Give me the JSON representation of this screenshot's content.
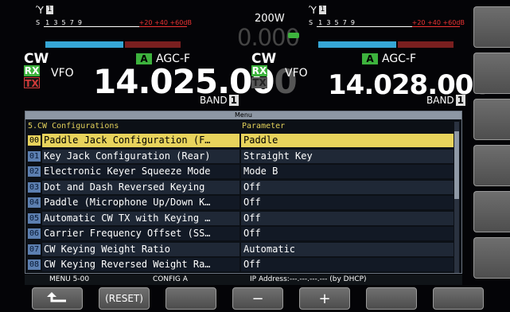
{
  "left_vfo": {
    "meter_scale": "S 1 3 5 7 9 +20 +40 +60dB",
    "meter_scale_red": "+20 +40 +60dB",
    "antenna_num": "1",
    "mode": "CW",
    "agc_badge": "A",
    "agc": "AGC-F",
    "rx_label": "RX",
    "tx_label": "TX",
    "vfo_label": "VFO",
    "freq_main": "14.025.00",
    "freq_dim": "0",
    "band_label": "BAND",
    "band_num": "1"
  },
  "center": {
    "power": "200W",
    "power_value": "0.000"
  },
  "right_vfo": {
    "meter_scale": "S 1 3 5 7 9 +20 +40 +60dB",
    "antenna_num": "1",
    "mode": "CW",
    "agc_badge": "A",
    "agc": "AGC-F",
    "rx_label": "RX",
    "tx_label": "TX",
    "vfo_label": "VFO",
    "freq_main": "14.028.00",
    "freq_dim": "0",
    "band_label": "BAND",
    "band_num": "1"
  },
  "menu": {
    "title": "Menu",
    "group_header": "5.CW Configurations",
    "param_header": "Parameter",
    "rows": [
      {
        "num": "00",
        "name": "Paddle Jack Configuration (F…",
        "value": "Paddle"
      },
      {
        "num": "01",
        "name": "Key Jack Configuration (Rear)",
        "value": "Straight Key"
      },
      {
        "num": "02",
        "name": "Electronic Keyer Squeeze Mode",
        "value": "Mode B"
      },
      {
        "num": "03",
        "name": "Dot and Dash Reversed Keying",
        "value": "Off"
      },
      {
        "num": "04",
        "name": "Paddle (Microphone Up/Down K…",
        "value": "Off"
      },
      {
        "num": "05",
        "name": "Automatic CW TX with Keying …",
        "value": "Off"
      },
      {
        "num": "06",
        "name": "Carrier Frequency Offset (SS…",
        "value": "Off"
      },
      {
        "num": "07",
        "name": "CW Keying Weight Ratio",
        "value": "Automatic"
      },
      {
        "num": "08",
        "name": "CW Keying Reversed Weight Ra…",
        "value": "Off"
      }
    ]
  },
  "status_bar": {
    "menu_pos": "MENU 5-00",
    "config": "CONFIG A",
    "ip": "IP Address:---.---.---.--- (by DHCP)"
  },
  "function_keys": {
    "back_icon": "return-arrow-icon",
    "reset": "(RESET)",
    "minus": "−",
    "plus": "+"
  },
  "colors": {
    "selected_row": "#e8d35c",
    "rx_green": "#3db33d",
    "tx_red": "#d23a3a",
    "header_yellow": "#e2d05a"
  }
}
